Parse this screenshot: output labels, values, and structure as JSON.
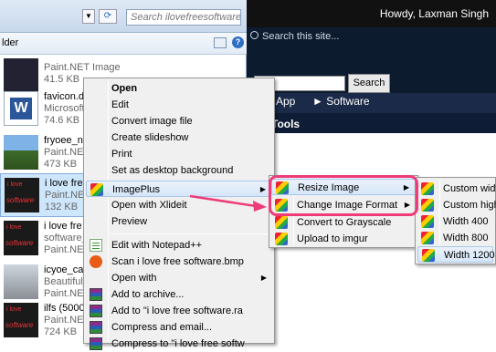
{
  "webpage": {
    "greeting": "Howdy, Laxman Singh",
    "search_placeholder": "Search this site...",
    "search_button": "Search",
    "nav": [
      "App",
      "► Software"
    ],
    "subnav": "Tools"
  },
  "explorer": {
    "search_placeholder": "Search ilovefreesoftware",
    "folder_label": "lder",
    "files": [
      {
        "name": "",
        "type": "Paint.NET Image",
        "size": "41.5 KB"
      },
      {
        "name": "favicon.d",
        "type": "Microsoft",
        "size": "74.6 KB"
      },
      {
        "name": "fryoee_na",
        "type": "Paint.NET",
        "size": "473 KB"
      },
      {
        "name": "i love fre",
        "type": "Paint.NET",
        "size": "132 KB"
      },
      {
        "name": "i love fre",
        "type": "software_",
        "size": "Paint.NET"
      },
      {
        "name": "icyoe_car",
        "type": "Beautiful_",
        "size": "Paint.NET"
      },
      {
        "name": "ilfs (5000)",
        "type": "Paint.NET",
        "size": "724 KB"
      }
    ]
  },
  "context_menu": {
    "items": [
      "Open",
      "Edit",
      "Convert image file",
      "Create slideshow",
      "Print",
      "Set as desktop background",
      "ImagePlus",
      "Open with Xlideit",
      "Preview",
      "Edit with Notepad++",
      "Scan i love free software.bmp",
      "Open with",
      "Add to archive...",
      "Add to \"i love free software.ra",
      "Compress and email...",
      "Compress to \"i love free softw"
    ]
  },
  "imageplus_menu": {
    "items": [
      "Resize Image",
      "Change Image Format",
      "Convert to Grayscale",
      "Upload to imgur"
    ]
  },
  "resize_menu": {
    "items": [
      "Custom width",
      "Custom high",
      "Width 400",
      "Width 800",
      "Width 1200"
    ]
  },
  "colors": {
    "highlight": "#ee3b7a",
    "selection": "#cde6fb",
    "menu_bg": "#f0f0f0",
    "web_header": "#0d1b2e"
  }
}
